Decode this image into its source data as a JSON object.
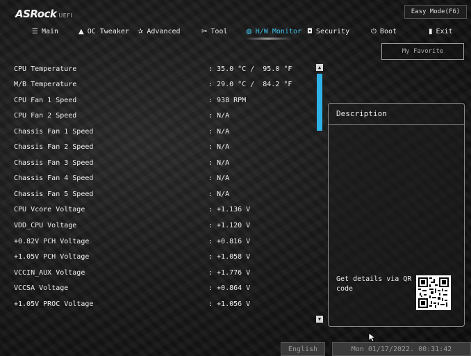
{
  "brand": {
    "logo": "ASRock",
    "sub": "UEFI"
  },
  "easy_mode": "Easy Mode(F6)",
  "menu": [
    {
      "label": "Main",
      "icon": "main-icon",
      "glyph": "☰"
    },
    {
      "label": "OC Tweaker",
      "icon": "rocket-icon",
      "glyph": "▲"
    },
    {
      "label": "Advanced",
      "icon": "star-icon",
      "glyph": "✰"
    },
    {
      "label": "Tool",
      "icon": "tool-icon",
      "glyph": "✂"
    },
    {
      "label": "H/W Monitor",
      "icon": "monitor-icon",
      "glyph": "◍"
    },
    {
      "label": "Security",
      "icon": "shield-icon",
      "glyph": "◘"
    },
    {
      "label": "Boot",
      "icon": "power-icon",
      "glyph": "⏻"
    },
    {
      "label": "Exit",
      "icon": "exit-icon",
      "glyph": "▮"
    }
  ],
  "my_favorite": "My Favorite",
  "sensors": [
    {
      "name": "CPU Temperature",
      "value": ": 35.0 °C /  95.0 °F"
    },
    {
      "name": "M/B Temperature",
      "value": ": 29.0 °C /  84.2 °F"
    },
    {
      "name": "CPU Fan 1 Speed",
      "value": ": 938 RPM"
    },
    {
      "name": "CPU Fan 2 Speed",
      "value": ": N/A"
    },
    {
      "name": "Chassis Fan 1 Speed",
      "value": ": N/A"
    },
    {
      "name": "Chassis Fan 2 Speed",
      "value": ": N/A"
    },
    {
      "name": "Chassis Fan 3 Speed",
      "value": ": N/A"
    },
    {
      "name": "Chassis Fan 4 Speed",
      "value": ": N/A"
    },
    {
      "name": "Chassis Fan 5 Speed",
      "value": ": N/A"
    },
    {
      "name": "CPU Vcore Voltage",
      "value": ": +1.136 V"
    },
    {
      "name": "VDD_CPU Voltage",
      "value": ": +1.120 V"
    },
    {
      "name": "+0.82V PCH Voltage",
      "value": ": +0.816 V"
    },
    {
      "name": "+1.05V PCH Voltage",
      "value": ": +1.058 V"
    },
    {
      "name": "VCCIN_AUX Voltage",
      "value": ": +1.776 V"
    },
    {
      "name": "VCCSA Voltage",
      "value": ": +0.864 V"
    },
    {
      "name": "+1.05V PROC Voltage",
      "value": ": +1.056 V"
    }
  ],
  "description": {
    "title": "Description",
    "qr_text": "Get details via QR code"
  },
  "footer": {
    "language": "English",
    "datetime": "Mon 01/17/2022. 00:31:42"
  },
  "colors": {
    "accent": "#3fc3ee",
    "scroll_thumb": "#2fb2e6"
  }
}
